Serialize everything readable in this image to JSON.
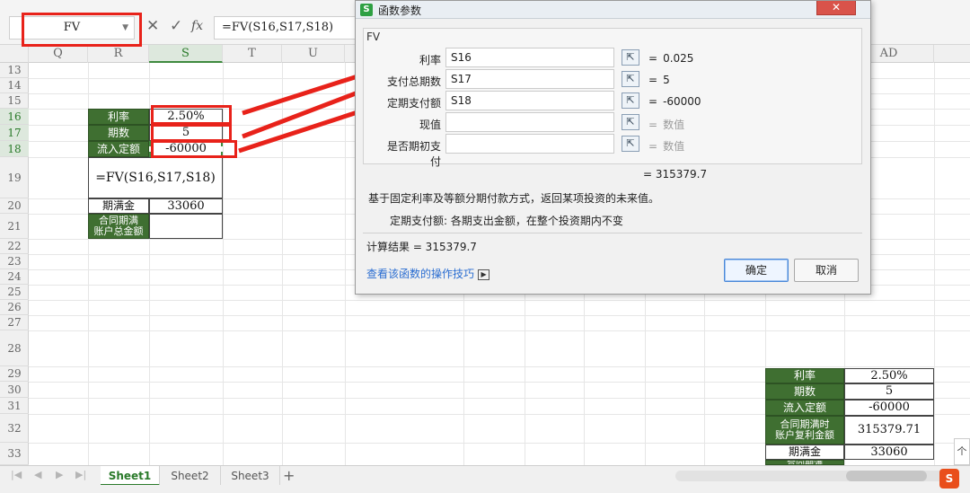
{
  "formula_bar": {
    "name_box": "FV",
    "formula": "=FV(S16,S17,S18)"
  },
  "columns": [
    "Q",
    "R",
    "S",
    "T",
    "U",
    "AD"
  ],
  "rows": [
    "13",
    "14",
    "15",
    "16",
    "17",
    "18",
    "19",
    "20",
    "21",
    "22",
    "23",
    "24",
    "25",
    "26",
    "27",
    "28",
    "29",
    "30",
    "31",
    "32",
    "33"
  ],
  "left_table": {
    "rate_label": "利率",
    "rate_value": "2.50%",
    "periods_label": "期数",
    "periods_value": "5",
    "payment_label": "流入定额",
    "payment_value": "-60000",
    "formula_text": "=FV(S16,S17,S18)",
    "maturity_label": "期满金",
    "maturity_value": "33060",
    "total_label": "合同期满\n账户总金额",
    "total_value": ""
  },
  "right_table": {
    "rate_label": "利率",
    "rate_value": "2.50%",
    "periods_label": "期数",
    "periods_value": "5",
    "payment_label": "流入定额",
    "payment_value": "-60000",
    "fv_label": "合同期满时\n账户复利金额",
    "fv_value": "315379.71",
    "maturity_label": "期满金",
    "maturity_value": "33060",
    "cut_label": "合同期满"
  },
  "dialog": {
    "title": "函数参数",
    "close": "✕",
    "function_name": "FV",
    "args": [
      {
        "label": "利率",
        "value": "S16",
        "result": "0.025",
        "dim": false
      },
      {
        "label": "支付总期数",
        "value": "S17",
        "result": "5",
        "dim": false
      },
      {
        "label": "定期支付额",
        "value": "S18",
        "result": "-60000",
        "dim": false
      },
      {
        "label": "现值",
        "value": "",
        "result": "数值",
        "dim": true
      },
      {
        "label": "是否期初支付",
        "value": "",
        "result": "数值",
        "dim": true
      }
    ],
    "equals": "=",
    "preview": "= 315379.7",
    "description": "基于固定利率及等额分期付款方式，返回某项投资的未来值。",
    "arg_help": "定期支付额:  各期支出金额，在整个投资期内不变",
    "calc_result": "计算结果 = 315379.7",
    "help_link": "查看该函数的操作技巧",
    "ok": "确定",
    "cancel": "取消"
  },
  "sheets": [
    "Sheet1",
    "Sheet2",
    "Sheet3"
  ],
  "active_sheet": "Sheet1",
  "icons": {
    "cancel": "✕",
    "confirm": "✓",
    "fx": "fx",
    "app": "S",
    "add": "+",
    "ime": "S",
    "up": "个"
  },
  "colors": {
    "label_fill": "#3f6f31",
    "highlight_red": "#e8221a",
    "link_blue": "#2a6dd1"
  }
}
